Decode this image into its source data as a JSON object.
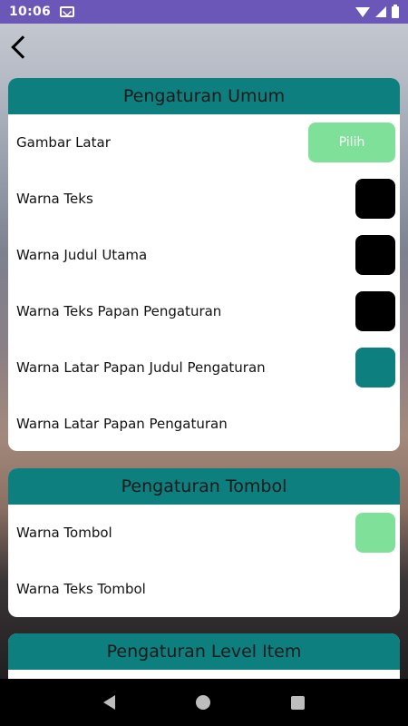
{
  "status_bar": {
    "time": "10:06"
  },
  "general_settings": {
    "title": "Pengaturan Umum",
    "rows": [
      {
        "label": "Gambar Latar",
        "button_label": "Pilih",
        "button_color": "#7fe09a"
      },
      {
        "label": "Warna Teks",
        "swatch_color": "#000000"
      },
      {
        "label": "Warna Judul Utama",
        "swatch_color": "#000000"
      },
      {
        "label": "Warna Teks Papan Pengaturan",
        "swatch_color": "#000000"
      },
      {
        "label": "Warna Latar Papan Judul Pengaturan",
        "swatch_color": "#0d7f7e"
      },
      {
        "label": "Warna Latar Papan Pengaturan"
      }
    ]
  },
  "button_settings": {
    "title": "Pengaturan Tombol",
    "rows": [
      {
        "label": "Warna Tombol",
        "swatch_color": "#7fe09a"
      },
      {
        "label": "Warna Teks Tombol"
      }
    ]
  },
  "level_item_settings": {
    "title": "Pengaturan Level Item"
  },
  "theme": {
    "header_color": "#0d7f7e",
    "status_bar_color": "#6b57b8"
  }
}
